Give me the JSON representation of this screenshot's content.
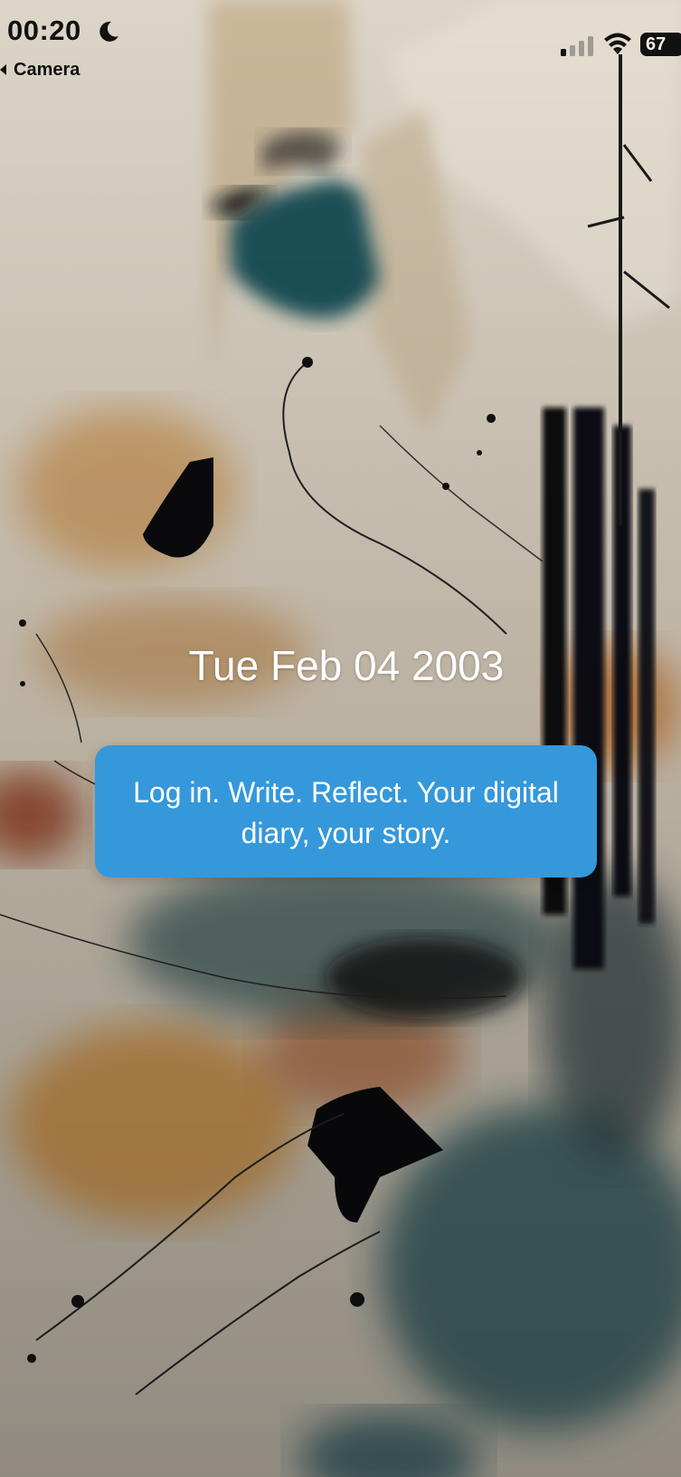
{
  "status_bar": {
    "time": "00:20",
    "focus_icon": "moon-icon",
    "signal_icon": "cellular-signal-icon",
    "wifi_icon": "wifi-icon",
    "battery_level": "67",
    "back_app_label": "Camera"
  },
  "main": {
    "date": "Tue Feb 04 2003",
    "tagline": "Log in. Write. Reflect. Your digital diary, your story."
  },
  "colors": {
    "card_background": "#3498db",
    "card_text": "#ffffff",
    "date_text": "#ffffff",
    "status_text": "#111111"
  },
  "background": {
    "description": "abstract-ink-painting",
    "palette": [
      "#d8d0c1",
      "#1d4850",
      "#0b0b0e",
      "#b8782e",
      "#8a3416"
    ]
  }
}
